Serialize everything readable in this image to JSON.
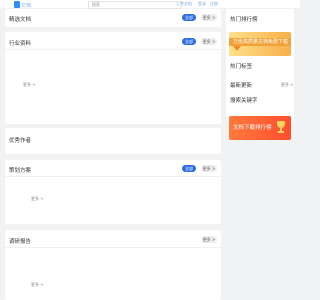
{
  "header": {
    "logo_text": "文档",
    "search_placeholder": "搜索",
    "nav": [
      "上传文档",
      "登录",
      "注册"
    ]
  },
  "main": {
    "sections": [
      {
        "title": "精选文档",
        "pill_blue": "全部",
        "pill_gray": "更多 >"
      },
      {
        "title": "行业资料",
        "pill_blue": "全部",
        "pill_gray": "更多 >",
        "more": "更多 >"
      },
      {
        "title": "优秀作者"
      },
      {
        "title": "策划方案",
        "pill_blue": "全部",
        "pill_gray": "更多 >",
        "more": "更多 >"
      },
      {
        "title": "调研报告",
        "pill_gray": "更多 >",
        "more": "更多 >"
      }
    ]
  },
  "sidebar": {
    "hot_rank_title": "热门排行榜",
    "ad1_text": "万份高质量文档免费下载",
    "hot_tags_title": "热门标签",
    "latest_title": "最新更新",
    "latest_more": "更多 >",
    "search_keywords_title": "搜索关键字",
    "ad2_text": "文档下载排行榜"
  },
  "colors": {
    "accent": "#2b6de5",
    "ad_orange": "#ff5a30",
    "ad_gold": "#f6b04a"
  }
}
